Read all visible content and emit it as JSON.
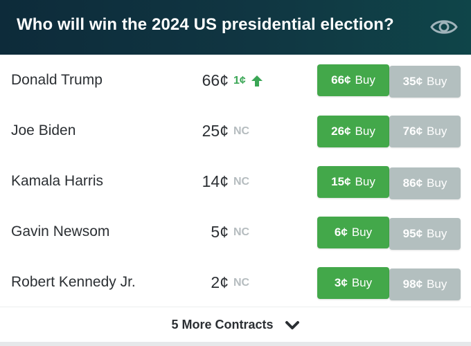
{
  "market": {
    "title": "Who will win the 2024 US presidential election?",
    "eye_icon": "eye-icon"
  },
  "contracts": [
    {
      "name": "Donald Trump",
      "price": "66¢",
      "change": "1¢",
      "change_direction": "up",
      "yes_price": "66¢",
      "yes_label": "Buy",
      "no_price": "35¢",
      "no_label": "Buy"
    },
    {
      "name": "Joe Biden",
      "price": "25¢",
      "change": "NC",
      "yes_price": "26¢",
      "yes_label": "Buy",
      "no_price": "76¢",
      "no_label": "Buy"
    },
    {
      "name": "Kamala Harris",
      "price": "14¢",
      "change": "NC",
      "yes_price": "15¢",
      "yes_label": "Buy",
      "no_price": "86¢",
      "no_label": "Buy"
    },
    {
      "name": "Gavin Newsom",
      "price": "5¢",
      "change": "NC",
      "yes_price": "6¢",
      "yes_label": "Buy",
      "no_price": "95¢",
      "no_label": "Buy"
    },
    {
      "name": "Robert Kennedy Jr.",
      "price": "2¢",
      "change": "NC",
      "yes_price": "3¢",
      "yes_label": "Buy",
      "no_price": "98¢",
      "no_label": "Buy"
    }
  ],
  "more": {
    "label": "5 More Contracts",
    "icon": "chevron-down-icon"
  },
  "colors": {
    "header_bg": "#0f3a45",
    "buy_yes": "#43a84a",
    "buy_no": "#b3bfbf",
    "change_up": "#3aa655",
    "change_nc": "#b5bcbf"
  }
}
